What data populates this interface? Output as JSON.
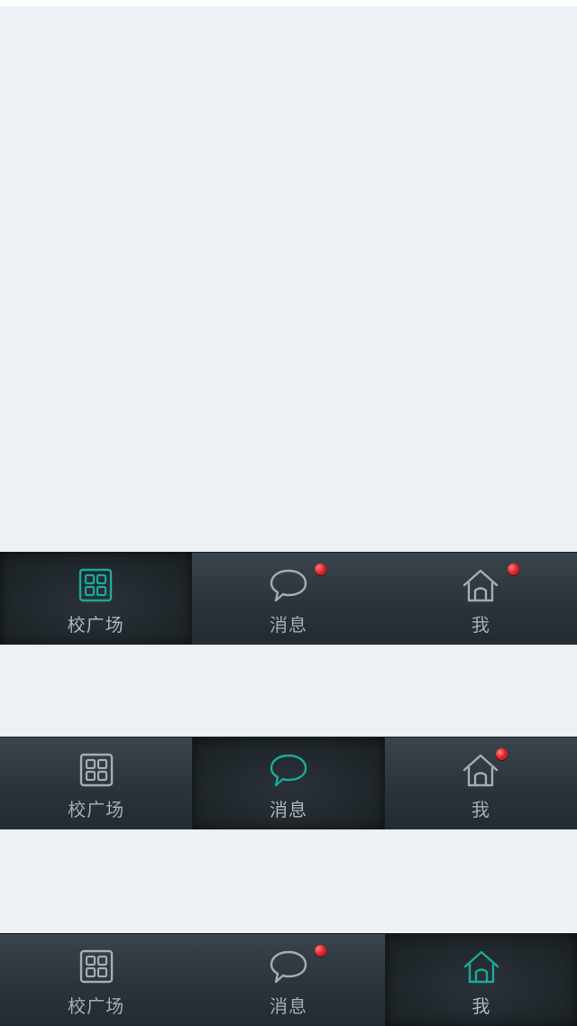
{
  "colors": {
    "page_bg": "#edf0f5",
    "tabbar_bg": "#2b343b",
    "active_icon": "#1aa99a",
    "inactive_icon": "#a5adb4",
    "badge_dot": "#e8252a"
  },
  "tabbars": [
    {
      "active": "square",
      "tabs": [
        {
          "label": "校广场",
          "icon": "grid-icon",
          "badge": false
        },
        {
          "label": "消息",
          "icon": "chat-bubble-icon",
          "badge": true
        },
        {
          "label": "我",
          "icon": "home-icon",
          "badge": true
        }
      ]
    },
    {
      "active": "messages",
      "tabs": [
        {
          "label": "校广场",
          "icon": "grid-icon",
          "badge": false
        },
        {
          "label": "消息",
          "icon": "chat-bubble-icon",
          "badge": false
        },
        {
          "label": "我",
          "icon": "home-icon",
          "badge": true
        }
      ]
    },
    {
      "active": "me",
      "tabs": [
        {
          "label": "校广场",
          "icon": "grid-icon",
          "badge": false
        },
        {
          "label": "消息",
          "icon": "chat-bubble-icon",
          "badge": true
        },
        {
          "label": "我",
          "icon": "home-icon",
          "badge": false
        }
      ]
    }
  ]
}
